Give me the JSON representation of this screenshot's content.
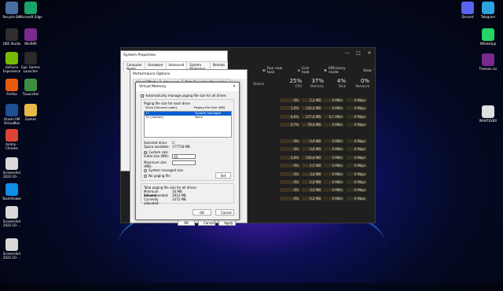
{
  "desktop": {
    "left_icons": [
      {
        "label": "Recycle Bin",
        "icon": "recycle-bin-icon",
        "color": "#4a6fa5"
      },
      {
        "label": "Microsoft Edge",
        "icon": "edge-icon",
        "color": "#1aa36b"
      },
      {
        "label": "OBS Studio",
        "icon": "obs-icon",
        "color": "#302e31"
      },
      {
        "label": "WinRAR",
        "icon": "winrar-icon",
        "color": "#7a2a8c"
      },
      {
        "label": "GeForce Experience",
        "icon": "geforce-icon",
        "color": "#76b900"
      },
      {
        "label": "Epic Games Launcher",
        "icon": "epic-icon",
        "color": "#2a2a2a"
      },
      {
        "label": "Firefox",
        "icon": "firefox-icon",
        "color": "#e8590c"
      },
      {
        "label": "TLauncher",
        "icon": "tlauncher-icon",
        "color": "#3d8c40"
      },
      {
        "label": "Oracle VM VirtualBox",
        "icon": "virtualbox-icon",
        "color": "#1d4f91"
      },
      {
        "label": "Games",
        "icon": "folder-icon",
        "color": "#e8b84a"
      },
      {
        "label": "Andriy - Chrome",
        "icon": "chrome-icon",
        "color": "#db4437"
      },
      {
        "label": "Screenshot 2022-10-...",
        "icon": "file-icon",
        "color": "#d9d9d9"
      },
      {
        "label": "TeamViewer",
        "icon": "teamviewer-icon",
        "color": "#0e8ee9"
      },
      {
        "label": "Screenshot 2022-10-...",
        "icon": "file-icon",
        "color": "#d9d9d9"
      },
      {
        "label": "Screenshot 2022-10-...",
        "icon": "file-icon",
        "color": "#d9d9d9"
      }
    ],
    "right_icons": [
      {
        "label": "Discord",
        "icon": "discord-icon",
        "color": "#5865f2"
      },
      {
        "label": "Telegram",
        "icon": "telegram-icon",
        "color": "#2aa3df"
      },
      {
        "label": "WhatsApp",
        "icon": "whatsapp-icon",
        "color": "#25d366"
      },
      {
        "label": "Themes.rar",
        "icon": "winrar-icon",
        "color": "#7a2a8c"
      },
      {
        "label": "WHATEVER",
        "icon": "file-icon",
        "color": "#e0e0e0"
      }
    ]
  },
  "task_manager": {
    "toolbar": {
      "run_new_task": "Run new task",
      "end_task": "End task",
      "efficiency_mode": "Efficiency mode",
      "view": "View"
    },
    "columns": {
      "status": "Status",
      "cpu_pct": "25%",
      "cpu": "CPU",
      "memory_pct": "37%",
      "memory": "Memory",
      "disk_pct": "4%",
      "disk": "Disk",
      "network_pct": "0%",
      "network": "Network"
    },
    "fragments": [
      "ace...",
      "ack...",
      "table"
    ],
    "rows": [
      {
        "cpu": "0%",
        "mem": "2,2 MB",
        "disk": "0 MB/s",
        "net": "0 Mbps"
      },
      {
        "cpu": "1,0%",
        "mem": "142,4 MB",
        "disk": "0 MB/s",
        "net": "0 Mbps"
      },
      {
        "cpu": "6,6%",
        "mem": "177,6 MB",
        "disk": "0,1 MB/s",
        "net": "0 Mbps"
      },
      {
        "cpu": "0,7%",
        "mem": "78,6 MB",
        "disk": "0 MB/s",
        "net": "0 Mbps"
      },
      {
        "cpu": "",
        "mem": "",
        "disk": "",
        "net": ""
      },
      {
        "cpu": "0%",
        "mem": "0,9 MB",
        "disk": "0 MB/s",
        "net": "0 Mbps"
      },
      {
        "cpu": "0%",
        "mem": "0,8 MB",
        "disk": "0 MB/s",
        "net": "0 Mbps"
      },
      {
        "cpu": "2,8%",
        "mem": "156,8 MB",
        "disk": "0 MB/s",
        "net": "0 Mbps"
      },
      {
        "cpu": "0%",
        "mem": "1,5 MB",
        "disk": "0 MB/s",
        "net": "0 Mbps"
      },
      {
        "cpu": "0%",
        "mem": "3,6 MB",
        "disk": "0 MB/s",
        "net": "0 Mbps"
      },
      {
        "cpu": "0%",
        "mem": "2,0 MB",
        "disk": "0 MB/s",
        "net": "0 Mbps"
      },
      {
        "cpu": "0%",
        "mem": "3,0 MB",
        "disk": "0 MB/s",
        "net": "0 Mbps"
      },
      {
        "cpu": "0%",
        "mem": "0,2 MB",
        "disk": "0 MB/s",
        "net": "0 Mbps"
      }
    ]
  },
  "system_properties": {
    "title": "System Properties",
    "tabs": [
      "Computer Name",
      "Hardware",
      "Advanced",
      "System Protection",
      "Remote"
    ]
  },
  "performance_options": {
    "title": "Performance Options",
    "tabs": [
      "Visual Effects",
      "Advanced",
      "Data Execution Prevention"
    ],
    "ok": "OK",
    "cancel": "Cancel",
    "apply": "Apply"
  },
  "virtual_memory": {
    "title": "Virtual Memory",
    "auto_manage": "Automatically manage paging file size for all drives",
    "paging_group": "Paging file size for each drive",
    "drive_col": "Drive [Volume Label]",
    "size_col": "Paging File Size (MB)",
    "drives": [
      {
        "drive": "C:",
        "size": "System managed"
      },
      {
        "drive": "D:        [Games]",
        "size": "None"
      }
    ],
    "selected_drive_label": "Selected drive:",
    "selected_drive": "C:",
    "space_available_label": "Space available:",
    "space_available": "177730 MB",
    "custom_size": "Custom size:",
    "initial_size_label": "Initial size (MB):",
    "initial_size": "10",
    "maximum_size_label": "Maximum size (MB):",
    "maximum_size": "",
    "system_managed": "System managed size",
    "no_paging": "No paging file",
    "set": "Set",
    "total_group": "Total paging file size for all drives",
    "min_allowed_label": "Minimum allowed:",
    "min_allowed": "16 MB",
    "recommended_label": "Recommended:",
    "recommended": "2914 MB",
    "currently_label": "Currently allocated:",
    "currently": "1472 MB",
    "ok": "OK",
    "cancel": "Cancel"
  }
}
